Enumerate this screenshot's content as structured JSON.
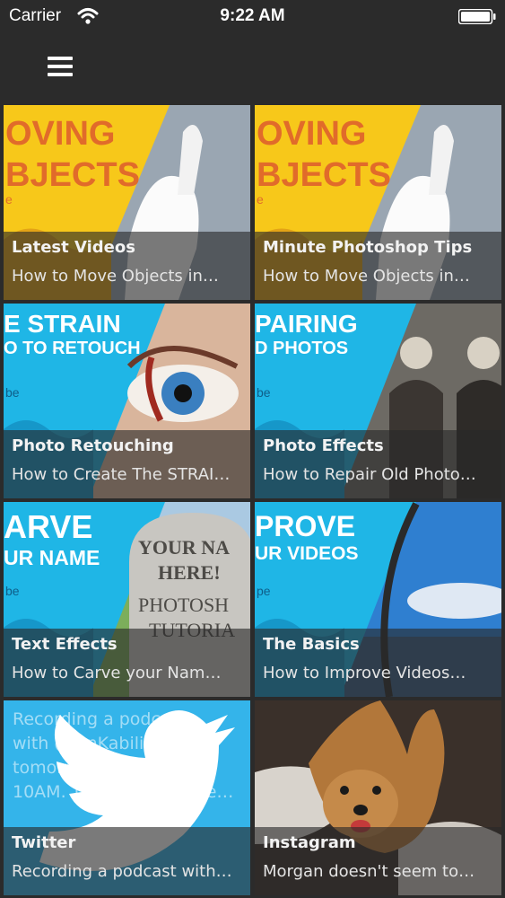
{
  "status_bar": {
    "carrier": "Carrier",
    "time": "9:22 AM",
    "wifi_icon": "wifi-icon",
    "battery_icon": "battery-full-icon"
  },
  "nav": {
    "menu_icon": "hamburger-menu-icon"
  },
  "tiles": [
    {
      "title": "Latest Videos",
      "subtitle": "How to Move Objects in…",
      "art_text": [
        "OVING",
        "BJECTS"
      ],
      "art_letter": "e"
    },
    {
      "title": "Minute Photoshop Tips",
      "subtitle": "How to Move Objects in…",
      "art_text": [
        "OVING",
        "BJECTS"
      ],
      "art_letter": "e"
    },
    {
      "title": "Photo Retouching",
      "subtitle": "How to Create The STRAI…",
      "art_text": [
        "E STRAIN",
        "O TO RETOUCH"
      ],
      "art_letter": "be"
    },
    {
      "title": "Photo Effects",
      "subtitle": "How to Repair Old Photo…",
      "art_text": [
        "PAIRING",
        "D PHOTOS"
      ],
      "art_letter": "be"
    },
    {
      "title": "Text Effects",
      "subtitle": "How to Carve your Nam…",
      "art_text": [
        "ARVE",
        "UR NAME"
      ],
      "art_letter": "be",
      "stone_text": [
        "YOUR NA",
        "HERE!",
        "PHOTOSH",
        "TUTORIA"
      ]
    },
    {
      "title": "The Basics",
      "subtitle": "How to Improve Videos…",
      "art_text": [
        "PROVE",
        "UR VIDEOS"
      ],
      "art_letter": "pe"
    },
    {
      "title": "Twitter",
      "subtitle": "Recording a podcast with…",
      "tweet_lines": [
        "Recording a podcast",
        "with @JanKabili",
        "tomorrow morning at",
        "10AM. This means I nee…"
      ]
    },
    {
      "title": "Instagram",
      "subtitle": "Morgan doesn't seem to…"
    }
  ],
  "colors": {
    "background": "#2b2b2b",
    "yellow": "#f7c81a",
    "cyan": "#1fb6e6",
    "dark_blue": "#1697c9",
    "twitter_blue": "#34b4ea"
  }
}
